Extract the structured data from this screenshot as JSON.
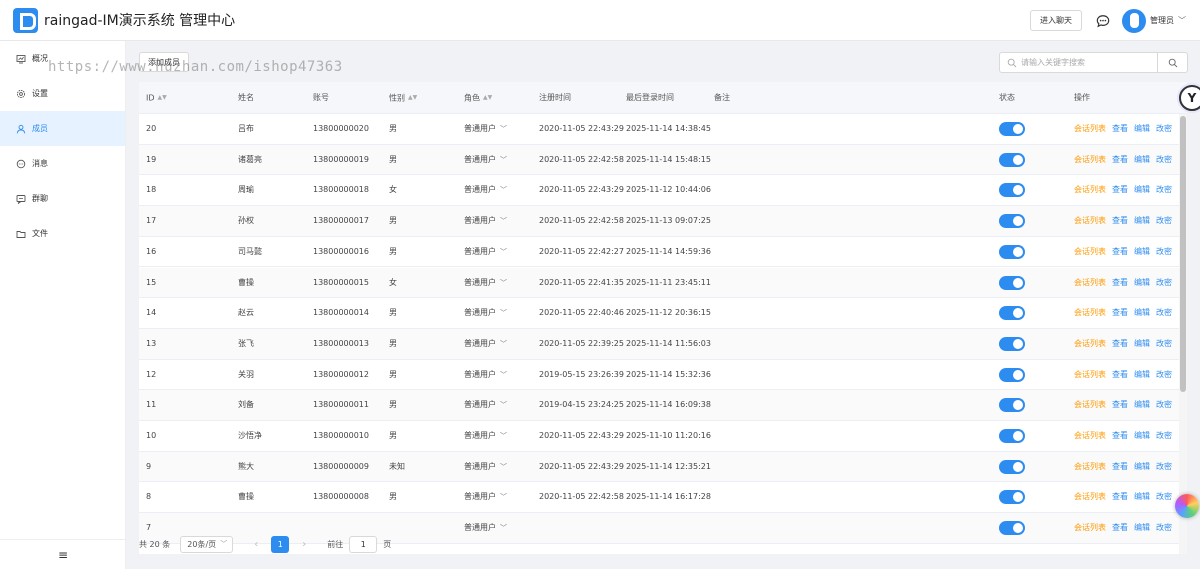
{
  "header": {
    "app_title": "raingad-IM演示系统 管理中心",
    "chat_button": "进入聊天",
    "admin_name": "管理员",
    "caret": "﹀"
  },
  "sidebar": {
    "items": [
      {
        "label": "概况",
        "icon": "overview-icon"
      },
      {
        "label": "设置",
        "icon": "settings-icon"
      },
      {
        "label": "成员",
        "icon": "user-icon"
      },
      {
        "label": "消息",
        "icon": "message-icon"
      },
      {
        "label": "群聊",
        "icon": "group-chat-icon"
      },
      {
        "label": "文件",
        "icon": "folder-icon"
      }
    ],
    "active_index": 2,
    "collapse_icon": "≡"
  },
  "toolbar": {
    "add_member": "添加成员",
    "search_placeholder": "请输入关键字搜索",
    "watermark": "https://www.huzhan.com/ishop47363"
  },
  "table": {
    "columns": {
      "id": "ID",
      "name": "姓名",
      "account": "账号",
      "gender": "性别",
      "role": "角色",
      "register_time": "注册时间",
      "last_login": "最后登录时间",
      "remark": "备注",
      "status": "状态",
      "actions": "操作"
    },
    "action_labels": {
      "sessions": "会话列表",
      "view": "查看",
      "edit": "编辑",
      "password": "改密"
    },
    "rows": [
      {
        "id": "20",
        "name": "吕布",
        "account": "13800000020",
        "gender": "男",
        "role": "普通用户",
        "register_time": "2020-11-05 22:43:29",
        "last_login": "2025-11-14 14:38:45",
        "enabled": true
      },
      {
        "id": "19",
        "name": "诸葛亮",
        "account": "13800000019",
        "gender": "男",
        "role": "普通用户",
        "register_time": "2020-11-05 22:42:58",
        "last_login": "2025-11-14 15:48:15",
        "enabled": true
      },
      {
        "id": "18",
        "name": "周瑜",
        "account": "13800000018",
        "gender": "女",
        "role": "普通用户",
        "register_time": "2020-11-05 22:43:29",
        "last_login": "2025-11-12 10:44:06",
        "enabled": true
      },
      {
        "id": "17",
        "name": "孙权",
        "account": "13800000017",
        "gender": "男",
        "role": "普通用户",
        "register_time": "2020-11-05 22:42:58",
        "last_login": "2025-11-13 09:07:25",
        "enabled": true
      },
      {
        "id": "16",
        "name": "司马懿",
        "account": "13800000016",
        "gender": "男",
        "role": "普通用户",
        "register_time": "2020-11-05 22:42:27",
        "last_login": "2025-11-14 14:59:36",
        "enabled": true
      },
      {
        "id": "15",
        "name": "曹操",
        "account": "13800000015",
        "gender": "女",
        "role": "普通用户",
        "register_time": "2020-11-05 22:41:35",
        "last_login": "2025-11-11 23:45:11",
        "enabled": true
      },
      {
        "id": "14",
        "name": "赵云",
        "account": "13800000014",
        "gender": "男",
        "role": "普通用户",
        "register_time": "2020-11-05 22:40:46",
        "last_login": "2025-11-12 20:36:15",
        "enabled": true
      },
      {
        "id": "13",
        "name": "张飞",
        "account": "13800000013",
        "gender": "男",
        "role": "普通用户",
        "register_time": "2020-11-05 22:39:25",
        "last_login": "2025-11-14 11:56:03",
        "enabled": true
      },
      {
        "id": "12",
        "name": "关羽",
        "account": "13800000012",
        "gender": "男",
        "role": "普通用户",
        "register_time": "2019-05-15 23:26:39",
        "last_login": "2025-11-14 15:32:36",
        "enabled": true
      },
      {
        "id": "11",
        "name": "刘备",
        "account": "13800000011",
        "gender": "男",
        "role": "普通用户",
        "register_time": "2019-04-15 23:24:25",
        "last_login": "2025-11-14 16:09:38",
        "enabled": true
      },
      {
        "id": "10",
        "name": "沙悟净",
        "account": "13800000010",
        "gender": "男",
        "role": "普通用户",
        "register_time": "2020-11-05 22:43:29",
        "last_login": "2025-11-10 11:20:16",
        "enabled": true
      },
      {
        "id": "9",
        "name": "熊大",
        "account": "13800000009",
        "gender": "未知",
        "role": "普通用户",
        "register_time": "2020-11-05 22:43:29",
        "last_login": "2025-11-14 12:35:21",
        "enabled": true
      },
      {
        "id": "8",
        "name": "曹操",
        "account": "13800000008",
        "gender": "男",
        "role": "普通用户",
        "register_time": "2020-11-05 22:42:58",
        "last_login": "2025-11-14 16:17:28",
        "enabled": true
      },
      {
        "id": "7",
        "name": "",
        "account": "",
        "gender": "",
        "role": "普通用户",
        "register_time": "",
        "last_login": "",
        "enabled": true
      }
    ]
  },
  "pagination": {
    "total": "共 20 条",
    "page_size": "20条/页",
    "prev": "‹",
    "next": "›",
    "current_page": "1",
    "goto_label": "前往",
    "goto_value": "1",
    "goto_suffix": "页"
  },
  "floating": {
    "widget_letter": "Y"
  }
}
